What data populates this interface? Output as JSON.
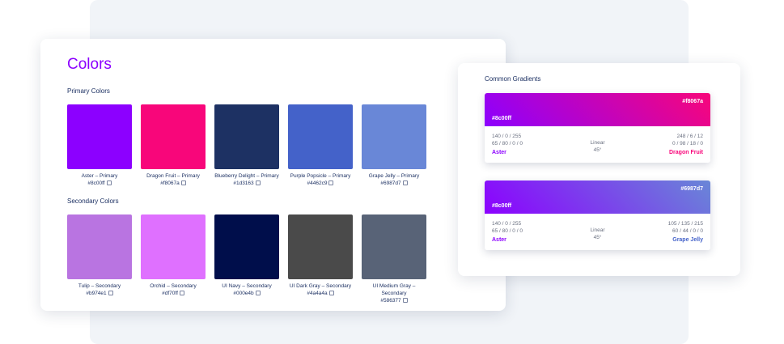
{
  "colors_card": {
    "title": "Colors",
    "primary_label": "Primary Colors",
    "secondary_label": "Secondary Colors",
    "primary": [
      {
        "name": "Aster – Primary",
        "hex": "#8c00ff",
        "color": "#8c00ff"
      },
      {
        "name": "Dragon Fruit – Primary",
        "hex": "#f8067a",
        "color": "#f8067a"
      },
      {
        "name": "Blueberry Delight – Primary",
        "hex": "#1d3163",
        "color": "#1d3163"
      },
      {
        "name": "Purple Popsicle – Primary",
        "hex": "#4462c9",
        "color": "#4462c9"
      },
      {
        "name": "Grape Jelly – Primary",
        "hex": "#6987d7",
        "color": "#6987d7"
      }
    ],
    "secondary": [
      {
        "name": "Tulip – Secondary",
        "hex": "#b974e1",
        "color": "#b974e1"
      },
      {
        "name": "Orchid – Secondary",
        "hex": "#df70ff",
        "color": "#df70ff"
      },
      {
        "name": "UI Navy – Secondary",
        "hex": "#000e4b",
        "color": "#000e4b"
      },
      {
        "name": "UI Dark Gray – Secondary",
        "hex": "#4a4a4a",
        "color": "#4a4a4a"
      },
      {
        "name": "UI Medium Gray – Secondary",
        "hex": "#586377",
        "color": "#586377"
      }
    ]
  },
  "gradients_card": {
    "title": "Common Gradients",
    "gradients": [
      {
        "start_hex": "#8c00ff",
        "end_hex": "#f8067a",
        "start_rgb": "140 / 0 / 255",
        "start_cmyk": "65 / 80 / 0 / 0",
        "end_rgb": "248 / 6 / 12",
        "end_cmyk": "0 / 98 / 18 / 0",
        "type": "Linear",
        "angle": "45°",
        "start_name": "Aster",
        "end_name": "Dragon Fruit",
        "start_color": "#8c00ff",
        "end_color": "#f8067a"
      },
      {
        "start_hex": "#8c00ff",
        "end_hex": "#6987d7",
        "start_rgb": "140 / 0 / 255",
        "start_cmyk": "65 / 80 / 0 / 0",
        "end_rgb": "105 / 135 / 215",
        "end_cmyk": "60 / 44 / 0 / 0",
        "type": "Linear",
        "angle": "45°",
        "start_name": "Aster",
        "end_name": "Grape Jelly",
        "start_color": "#8c00ff",
        "end_color": "#6987d7"
      }
    ]
  }
}
